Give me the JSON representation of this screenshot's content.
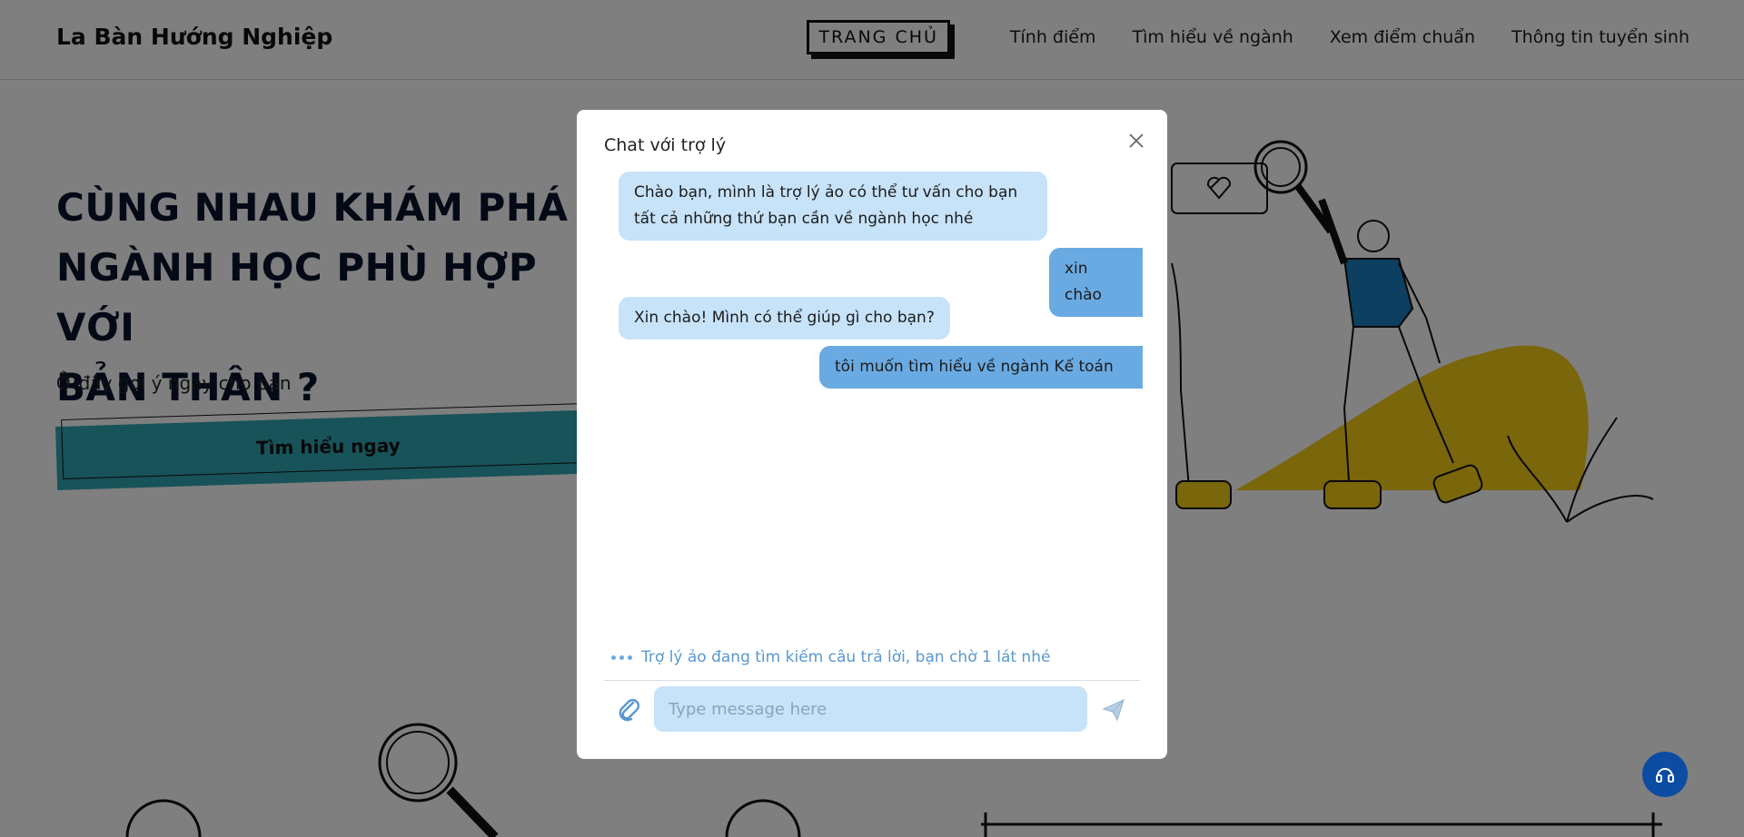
{
  "header": {
    "brand": "La Bàn Hướng Nghiệp",
    "nav": [
      "TRANG CHỦ",
      "Tính điểm",
      "Tìm hiểu về ngành",
      "Xem điểm chuẩn",
      "Thông tin tuyển sinh"
    ]
  },
  "hero": {
    "title_line1": "CÙNG NHAU KHÁM PHÁ",
    "title_line2": "NGÀNH HỌC PHÙ HỢP VỚI",
    "title_line3": "BẢN THÂN ?",
    "subtitle": "Ở đây gợi ý ngay cho bạn",
    "cta": "Tìm hiểu ngay"
  },
  "chat": {
    "title": "Chat với trợ lý",
    "messages": [
      {
        "from": "bot",
        "text_line1": "Chào bạn, mình là trợ lý ảo có thể tư vấn cho bạn",
        "text_line2": "tất cả những thứ bạn cần về ngành học nhé"
      },
      {
        "from": "user",
        "text": "xin chào"
      },
      {
        "from": "bot",
        "text": "Xin chào! Mình có thể giúp gì cho bạn?"
      },
      {
        "from": "user",
        "text": "tôi muốn tìm hiểu về ngành Kế toán"
      }
    ],
    "typing_status": "Trợ lý ảo đang tìm kiếm câu trả lời, bạn chờ 1 lát nhé",
    "input_placeholder": "Type message here",
    "input_value": ""
  },
  "colors": {
    "bot_bubble": "#c7e3fa",
    "user_bubble": "#6aaae2",
    "cta_accent": "#2ea6b3",
    "support_button": "#0c4ca3",
    "illustration_accent": "#f5cc16",
    "shirt": "#1a7fc1"
  },
  "icons": [
    "close-icon",
    "attach-icon",
    "send-icon",
    "headset-icon"
  ]
}
